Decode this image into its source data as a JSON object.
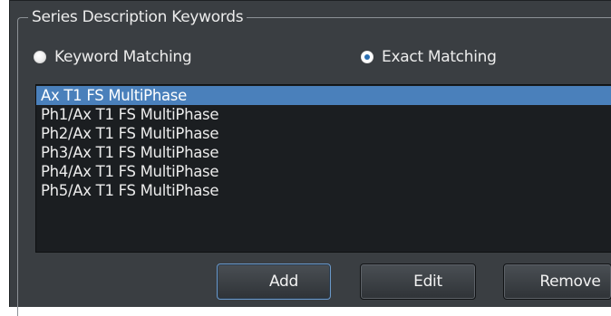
{
  "group": {
    "title": "Series Description Keywords"
  },
  "matching": {
    "keyword_label": "Keyword Matching",
    "exact_label": "Exact Matching",
    "selected": "exact"
  },
  "keywords": {
    "items": [
      "Ax T1 FS MultiPhase",
      "Ph1/Ax T1 FS MultiPhase",
      "Ph2/Ax T1 FS MultiPhase",
      "Ph3/Ax T1 FS MultiPhase",
      "Ph4/Ax T1 FS MultiPhase",
      "Ph5/Ax T1 FS MultiPhase"
    ],
    "selected_index": 0
  },
  "buttons": {
    "add_label": "Add",
    "edit_label": "Edit",
    "remove_label": "Remove"
  },
  "colors": {
    "panel_bg": "#3a3e42",
    "list_bg": "#1b1e21",
    "selection": "#4a80bb",
    "radio_accent": "#2a6fb2",
    "default_button_border": "#6a98c9"
  },
  "icons": {
    "keyword_radio": "radio-unchecked-icon",
    "exact_radio": "radio-checked-icon"
  }
}
